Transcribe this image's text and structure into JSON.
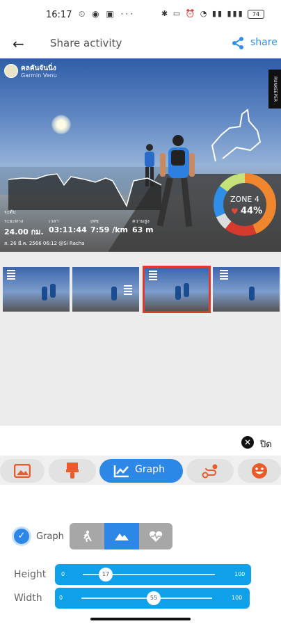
{
  "status": {
    "time": "16:17",
    "battery": "74"
  },
  "header": {
    "title": "Share activity",
    "share_label": "share"
  },
  "photo": {
    "user_name": "คลคันจันนิ่ง",
    "device": "Garmin Venu",
    "side_badge": "RUNKEEPER",
    "chart_label": "ระดับ",
    "stats": [
      {
        "label": "ระยะทาง",
        "value": "24.00 กม."
      },
      {
        "label": "เวลา",
        "value": "03:11:44"
      },
      {
        "label": "เพซ",
        "value": "7:59 /km"
      },
      {
        "label": "ความสูง",
        "value": "63 m"
      }
    ],
    "date": "ส. 26 มี.ค. 2566 06:12 @Si Racha",
    "zone": {
      "title": "ZONE 4",
      "percent": "44%"
    }
  },
  "panel": {
    "close_label": "ปิด",
    "tools": [
      {
        "icon": "image-icon"
      },
      {
        "icon": "paint-brush-icon"
      },
      {
        "icon": "chart-icon",
        "label": "Graph"
      },
      {
        "icon": "route-icon"
      },
      {
        "icon": "smiley-icon"
      }
    ],
    "graph_label": "Graph",
    "height": {
      "label": "Height",
      "min": "0",
      "max": "100",
      "value": "17"
    },
    "width": {
      "label": "Width",
      "min": "0",
      "max": "100",
      "value": "55"
    }
  },
  "colors": {
    "accent": "#2c87e6",
    "slider": "#0fa0ea",
    "selected_border": "#e0392d"
  }
}
